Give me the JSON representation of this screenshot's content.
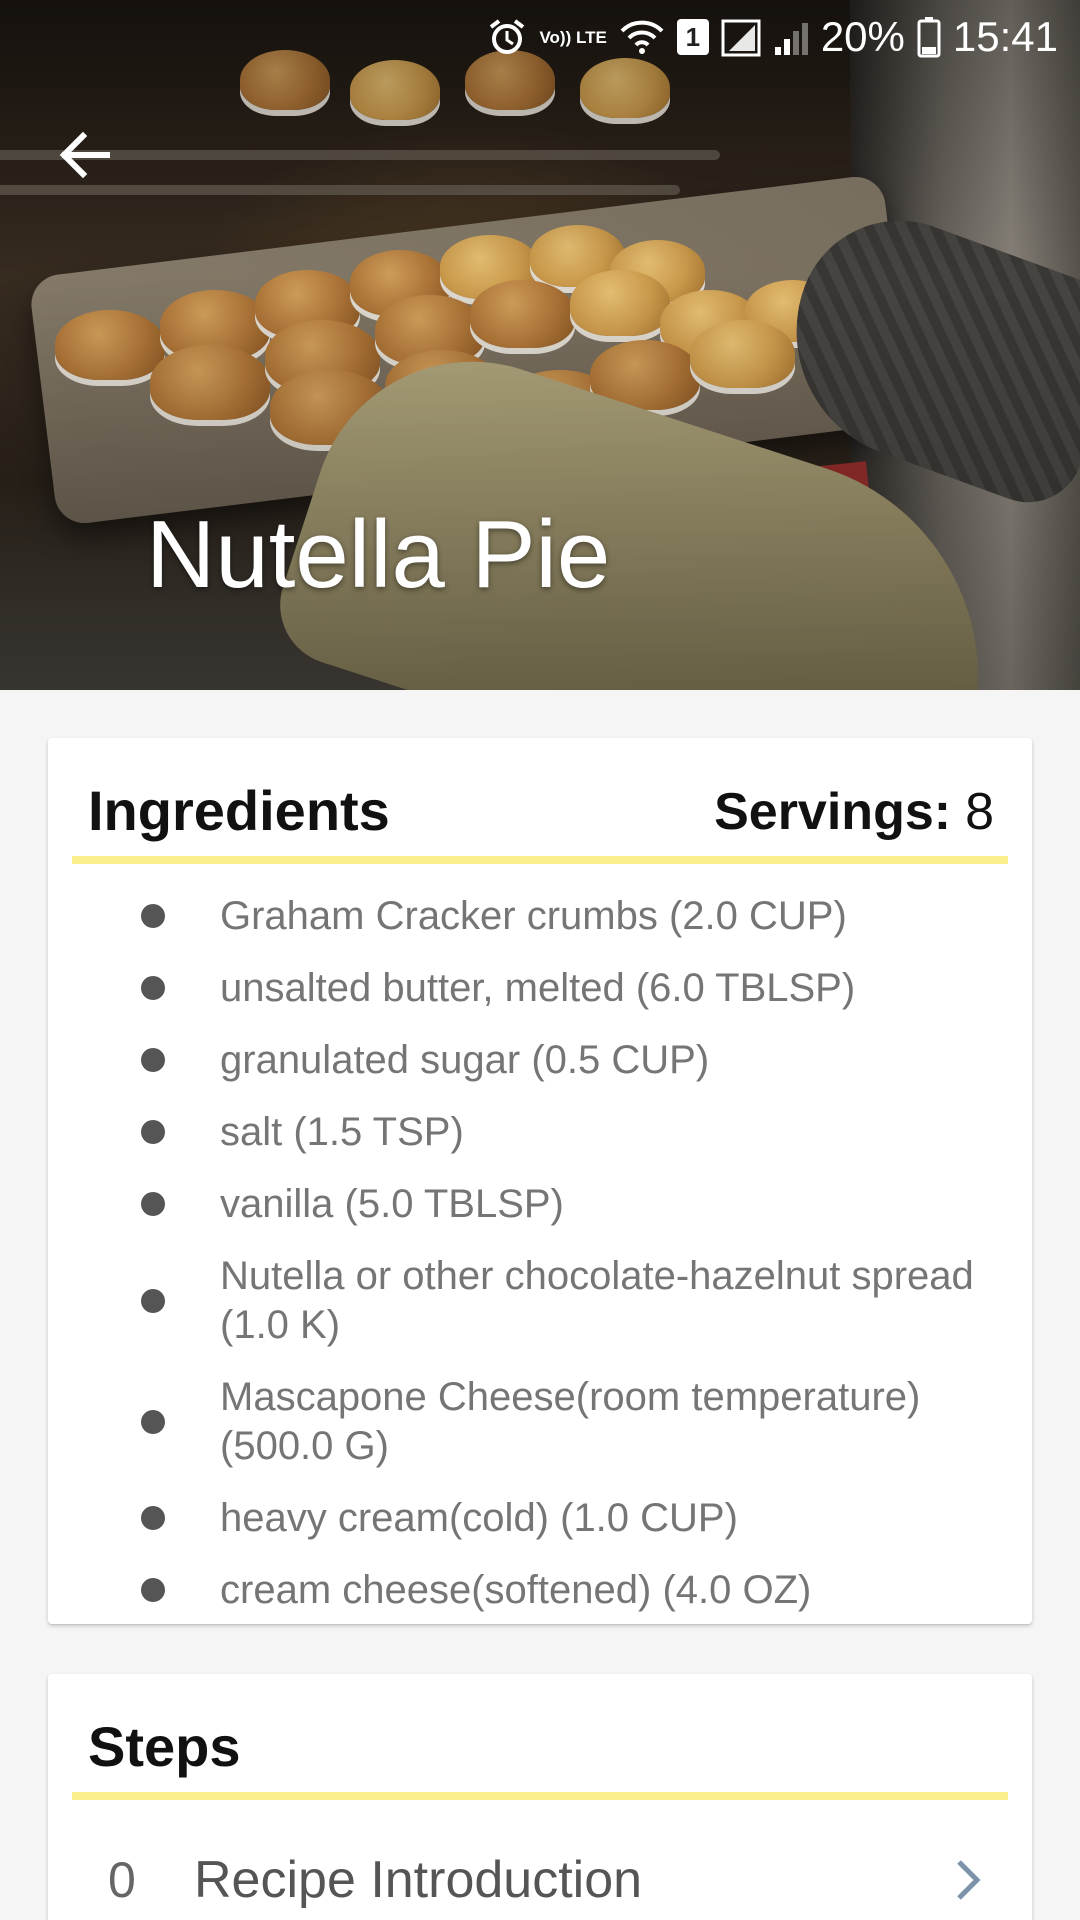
{
  "status_bar": {
    "icons": [
      "alarm-icon",
      "volte-icon",
      "wifi-icon",
      "sim-1-icon",
      "signal-icon",
      "signal-weak-icon",
      "battery-icon"
    ],
    "volte_label": "Vo)) LTE",
    "sim_label": "1",
    "battery": "20%",
    "time": "15:41"
  },
  "hero": {
    "title": "Nutella Pie",
    "back_icon": "arrow-left-icon"
  },
  "ingredients": {
    "heading": "Ingredients",
    "servings_label": "Servings:",
    "servings_value": "8",
    "items": [
      "Graham Cracker crumbs  (2.0 CUP)",
      "unsalted butter, melted  (6.0 TBLSP)",
      "granulated sugar  (0.5 CUP)",
      "salt  (1.5 TSP)",
      "vanilla  (5.0 TBLSP)",
      "Nutella or other chocolate-hazelnut spread  (1.0 K)",
      "Mascapone Cheese(room temperature)  (500.0 G)",
      "heavy cream(cold)  (1.0 CUP)",
      "cream cheese(softened)  (4.0 OZ)"
    ]
  },
  "steps": {
    "heading": "Steps",
    "items": [
      {
        "number": "0",
        "title": "Recipe Introduction"
      }
    ]
  },
  "colors": {
    "accent_underline": "#faef8c",
    "ingredient_text": "#757575",
    "background": "#f5f5f5"
  }
}
